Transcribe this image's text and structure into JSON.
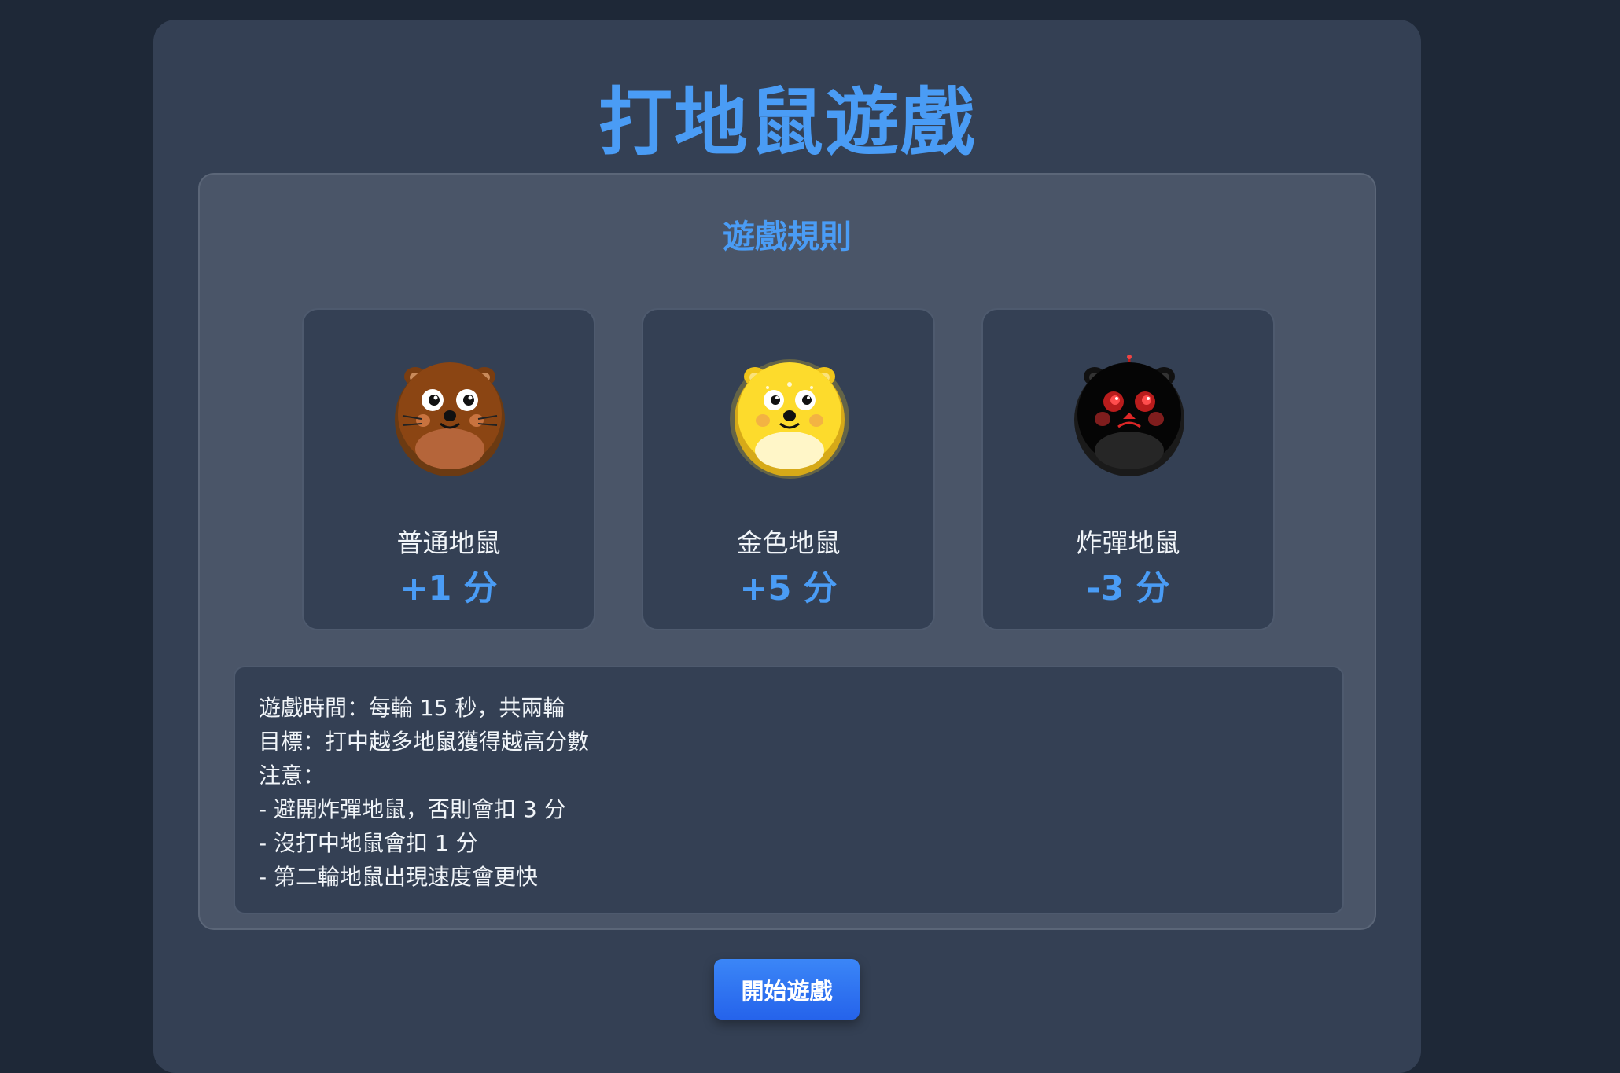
{
  "game": {
    "title": "打地鼠遊戲"
  },
  "rules": {
    "heading": "遊戲規則",
    "moles": [
      {
        "name": "普通地鼠",
        "points": "+1 分",
        "icon": "brown-mole-icon"
      },
      {
        "name": "金色地鼠",
        "points": "+5 分",
        "icon": "golden-mole-icon"
      },
      {
        "name": "炸彈地鼠",
        "points": "-3 分",
        "icon": "bomb-mole-icon"
      }
    ],
    "info_lines": [
      "遊戲時間：每輪 15 秒，共兩輪",
      "目標：打中越多地鼠獲得越高分數",
      "注意：",
      "- 避開炸彈地鼠，否則會扣 3 分",
      "- 沒打中地鼠會扣 1 分",
      "- 第二輪地鼠出現速度會更快"
    ]
  },
  "actions": {
    "start_label": "開始遊戲"
  },
  "colors": {
    "background": "#1e2837",
    "panel": "#344054",
    "accent": "#4a9cf5",
    "button": "#2563eb"
  }
}
